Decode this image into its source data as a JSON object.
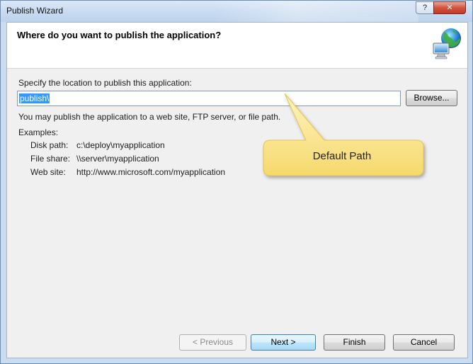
{
  "window": {
    "title": "Publish Wizard",
    "help_glyph": "?",
    "close_glyph": "✕"
  },
  "header": {
    "title": "Where do you want to publish the application?",
    "icon": "globe-computer-icon"
  },
  "form": {
    "prompt": "Specify the location to publish this application:",
    "location_value": "publish\\",
    "browse_label": "Browse...",
    "hint": "You may publish the application to a web site, FTP server, or file path.",
    "examples_label": "Examples:",
    "examples": [
      {
        "label": "Disk path:",
        "value": "c:\\deploy\\myapplication"
      },
      {
        "label": "File share:",
        "value": "\\\\server\\myapplication"
      },
      {
        "label": "Web site:",
        "value": "http://www.microsoft.com/myapplication"
      }
    ]
  },
  "callout": {
    "text": "Default Path",
    "color": "#fbe88e"
  },
  "buttons": {
    "previous": "< Previous",
    "next": "Next >",
    "finish": "Finish",
    "cancel": "Cancel"
  }
}
